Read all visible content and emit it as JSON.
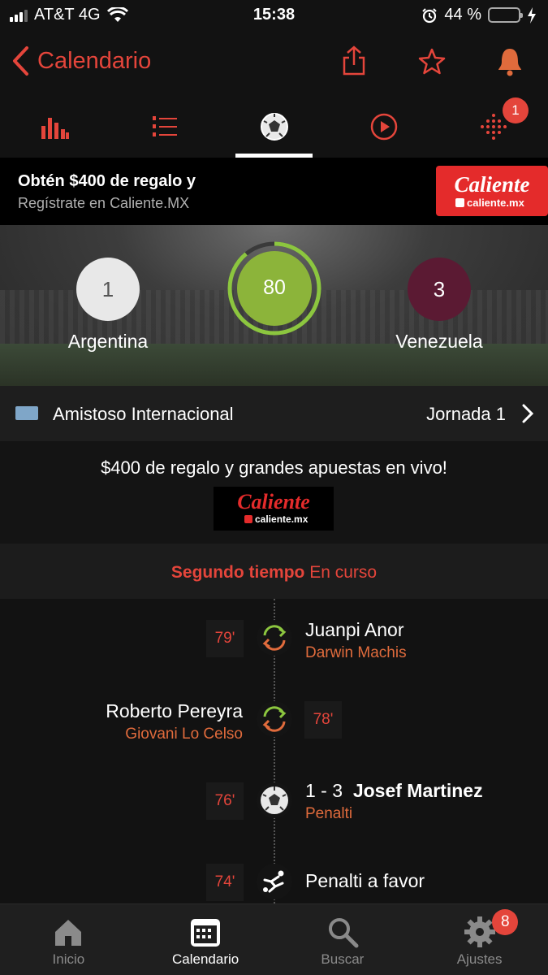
{
  "status_bar": {
    "carrier": "AT&T 4G",
    "time": "15:38",
    "battery": "44 %"
  },
  "header": {
    "back_label": "Calendario"
  },
  "tabs": [
    {
      "icon": "stats-icon"
    },
    {
      "icon": "list-icon"
    },
    {
      "icon": "soccer-ball-icon",
      "active": true
    },
    {
      "icon": "play-icon"
    },
    {
      "icon": "dots-icon",
      "badge": "1"
    }
  ],
  "ad_banner": {
    "title": "Obtén $400 de regalo y",
    "subtitle": "Regístrate en Caliente.MX",
    "logo_text": "Caliente",
    "logo_sub": "caliente.mx"
  },
  "match": {
    "home_team": "Argentina",
    "home_score": "1",
    "away_team": "Venezuela",
    "away_score": "3",
    "minute": "80",
    "minute_progress": 0.89
  },
  "competition": {
    "name": "Amistoso Internacional",
    "round": "Jornada 1"
  },
  "promo": {
    "text": "$400 de regalo y grandes apuestas en vivo!",
    "logo_text": "Caliente",
    "logo_sub": "caliente.mx"
  },
  "period": {
    "label": "Segundo tiempo",
    "status": "En curso"
  },
  "events": [
    {
      "minute": "79'",
      "main": "Juanpi Anor",
      "sub": "Darwin Machis",
      "type": "substitution",
      "side": "away"
    },
    {
      "minute": "78'",
      "main": "Roberto Pereyra",
      "sub": "Giovani Lo Celso",
      "type": "substitution",
      "side": "home"
    },
    {
      "minute": "76'",
      "score": "1 - 3",
      "main": "Josef Martinez",
      "sub": "Penalti",
      "type": "goal",
      "side": "away"
    },
    {
      "minute": "74'",
      "main": "Penalti a favor",
      "type": "penalty",
      "side": "away"
    }
  ],
  "tabbar": [
    {
      "label": "Inicio"
    },
    {
      "label": "Calendario",
      "active": true
    },
    {
      "label": "Buscar"
    },
    {
      "label": "Ajustes",
      "badge": "8"
    }
  ],
  "colors": {
    "accent": "#e4453b",
    "minute_ring": "#8cc63f",
    "away_color": "#5b1a33",
    "sub_text": "#e06b3c"
  }
}
